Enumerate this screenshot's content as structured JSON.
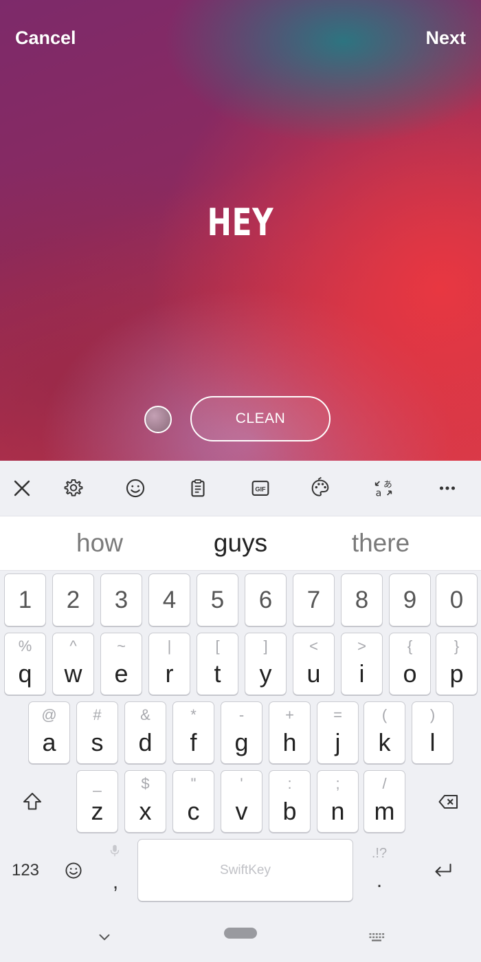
{
  "header": {
    "cancel": "Cancel",
    "next": "Next"
  },
  "story": {
    "text": "HEY",
    "style_button": "CLEAN"
  },
  "toolbar": {
    "icons": [
      "close-icon",
      "gear-icon",
      "emoji-icon",
      "clipboard-icon",
      "gif-icon",
      "palette-icon",
      "translate-icon",
      "more-icon"
    ],
    "gif_label": "GIF"
  },
  "suggestions": [
    "how",
    "guys",
    "there"
  ],
  "number_row": [
    "1",
    "2",
    "3",
    "4",
    "5",
    "6",
    "7",
    "8",
    "9",
    "0"
  ],
  "row1": {
    "keys": [
      "q",
      "w",
      "e",
      "r",
      "t",
      "y",
      "u",
      "i",
      "o",
      "p"
    ],
    "hints": [
      "%",
      "^",
      "~",
      "|",
      "[",
      "]",
      "<",
      ">",
      "{",
      "}"
    ]
  },
  "row2": {
    "keys": [
      "a",
      "s",
      "d",
      "f",
      "g",
      "h",
      "j",
      "k",
      "l"
    ],
    "hints": [
      "@",
      "#",
      "&",
      "*",
      "-",
      "+",
      "=",
      "(",
      ")"
    ]
  },
  "row3": {
    "keys": [
      "z",
      "x",
      "c",
      "v",
      "b",
      "n",
      "m"
    ],
    "hints": [
      "_",
      "$",
      "\"",
      "'",
      ":",
      ";",
      "/"
    ]
  },
  "bottom_row": {
    "numbers_key": "123",
    "comma": ",",
    "period": ".",
    "period_hint": ".!?",
    "space_brand": "SwiftKey"
  },
  "colors": {
    "keyboard_bg": "#eff0f4",
    "key_bg": "#ffffff",
    "text_white": "#ffffff"
  }
}
